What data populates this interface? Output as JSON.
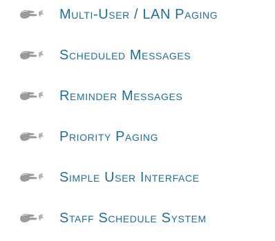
{
  "features": {
    "icon": "pointing-hand-icon",
    "label_color": "#1d6f9a",
    "items": [
      {
        "label": "Multi-User / LAN Paging"
      },
      {
        "label": "Scheduled Messages"
      },
      {
        "label": "Reminder Messages"
      },
      {
        "label": "Priority Paging"
      },
      {
        "label": "Simple User Interface"
      },
      {
        "label": "Staff Schedule System"
      }
    ]
  }
}
